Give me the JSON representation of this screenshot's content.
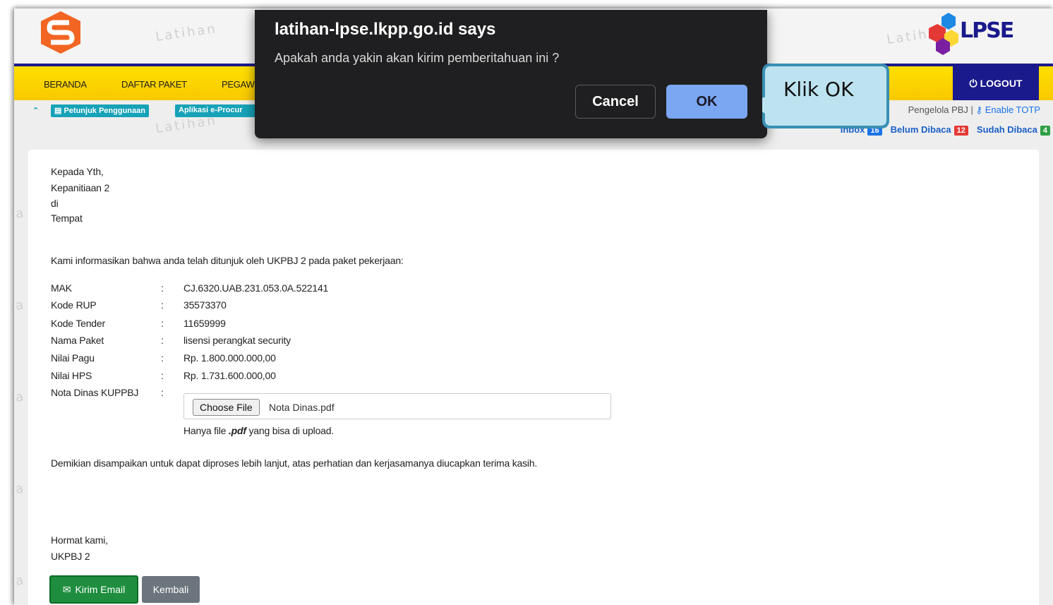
{
  "watermark": "Latihan",
  "header": {
    "brand": "LPSE"
  },
  "nav": {
    "items": [
      "BERANDA",
      "DAFTAR PAKET",
      "PEGAW"
    ],
    "logout": "LOGOUT"
  },
  "subbar": {
    "petunjuk": "Petunjuk Penggunaan",
    "aplikasi": "Aplikasi e-Procur",
    "role": "Pengelola PBJ |",
    "enable_totp": "Enable TOTP"
  },
  "inbox": {
    "inbox_label": "Inbox",
    "inbox_count": "16",
    "belum_label": "Belum Dibaca",
    "belum_count": "12",
    "sudah_label": "Sudah Dibaca",
    "sudah_count": "4"
  },
  "letter": {
    "greeting": [
      "Kepada Yth,",
      "Kepanitiaan 2",
      "di",
      "Tempat"
    ],
    "intro": "Kami informasikan bahwa anda telah ditunjuk oleh UKPBJ 2 pada paket pekerjaan:",
    "fields": [
      {
        "label": "MAK",
        "value": "CJ.6320.UAB.231.053.0A.522141"
      },
      {
        "label": "Kode RUP",
        "value": "35573370"
      },
      {
        "label": "Kode Tender",
        "value": "11659999"
      },
      {
        "label": "Nama Paket",
        "value": "lisensi perangkat security"
      },
      {
        "label": "Nilai Pagu",
        "value": "Rp. 1.800.000.000,00"
      },
      {
        "label": "Nilai HPS",
        "value": "Rp. 1.731.600.000,00"
      },
      {
        "label": "Nota Dinas KUPPBJ",
        "value": ""
      }
    ],
    "colon": ":",
    "choose_file": "Choose File",
    "file_name": "Nota Dinas.pdf",
    "hint_pre": "Hanya file ",
    "hint_ext": ".pdf",
    "hint_post": " yang bisa di upload.",
    "closing": "Demikian disampaikan untuk dapat diproses lebih lanjut, atas perhatian dan kerjasamanya diucapkan terima kasih.",
    "sign_off": [
      "Hormat kami,",
      "UKPBJ 2"
    ]
  },
  "buttons": {
    "kirim": "Kirim Email",
    "kembali": "Kembali"
  },
  "dialog": {
    "title": "latihan-lpse.lkpp.go.id says",
    "message": "Apakah anda yakin akan kirim pemberitahuan ini ?",
    "cancel": "Cancel",
    "ok": "OK"
  },
  "callout": {
    "text": "Klik OK"
  },
  "colors": {
    "accent_yellow": "#ffe000",
    "navy": "#1a1a8c",
    "dialog_bg": "#1f1f21",
    "ok_blue": "#7ba6f2",
    "callout_fill": "#bde3f0",
    "callout_border": "#3a8fb3"
  }
}
